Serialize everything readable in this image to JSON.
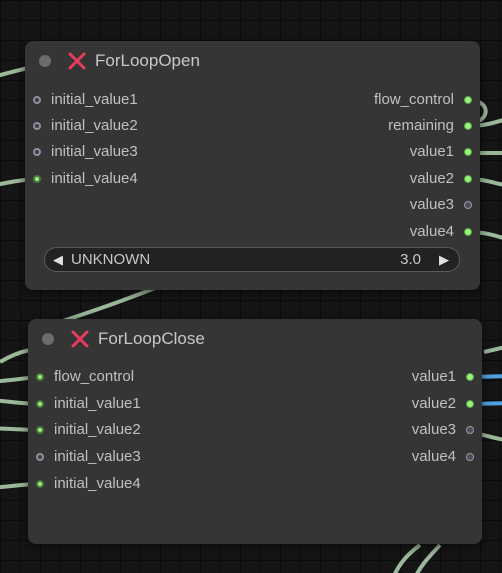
{
  "colors": {
    "canvas": "#151515",
    "node_body": "#353535",
    "badge_red": "#e53d5d",
    "link_green": "#9bb89b",
    "link_blue": "#4fa3e3"
  },
  "nodes": {
    "open": {
      "title": "ForLoopOpen",
      "badge_icon": "close-x-icon",
      "inputs": [
        {
          "label": "initial_value1",
          "linked": false
        },
        {
          "label": "initial_value2",
          "linked": false
        },
        {
          "label": "initial_value3",
          "linked": false
        },
        {
          "label": "initial_value4",
          "linked": true
        }
      ],
      "outputs": [
        {
          "label": "flow_control",
          "linked": true
        },
        {
          "label": "remaining",
          "linked": true
        },
        {
          "label": "value1",
          "linked": true
        },
        {
          "label": "value2",
          "linked": true
        },
        {
          "label": "value3",
          "linked": false
        },
        {
          "label": "value4",
          "linked": true
        }
      ],
      "widget": {
        "label": "UNKNOWN",
        "value": "3.0",
        "left_arrow": "◀",
        "right_arrow": "▶"
      }
    },
    "close": {
      "title": "ForLoopClose",
      "badge_icon": "close-x-icon",
      "inputs": [
        {
          "label": "flow_control",
          "linked": true
        },
        {
          "label": "initial_value1",
          "linked": true
        },
        {
          "label": "initial_value2",
          "linked": true
        },
        {
          "label": "initial_value3",
          "linked": false
        },
        {
          "label": "initial_value4",
          "linked": true
        }
      ],
      "outputs": [
        {
          "label": "value1",
          "linked": true
        },
        {
          "label": "value2",
          "linked": true
        },
        {
          "label": "value3",
          "linked": false
        },
        {
          "label": "value4",
          "linked": false
        }
      ]
    }
  }
}
